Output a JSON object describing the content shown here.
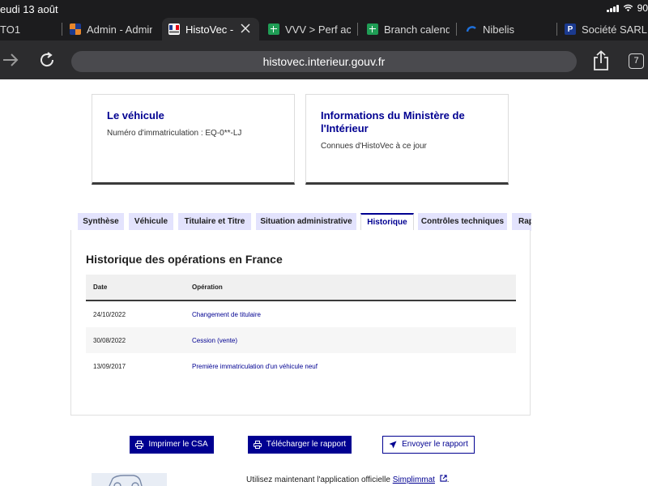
{
  "status_bar": {
    "time": "eudi 13 août",
    "battery": "90"
  },
  "browser_tabs": [
    {
      "label": "TO1",
      "icon": "none"
    },
    {
      "label": "Admin - Admin",
      "icon": "orange-blue-squares-icon",
      "icon_color": "#e8872b"
    },
    {
      "label": "HistoVec -",
      "icon": "histovec-logo-icon",
      "icon_color": "#ffffff",
      "active": true
    },
    {
      "label": "VVV > Perf ach",
      "icon": "green-grid-icon",
      "icon_color": "#1f9d55"
    },
    {
      "label": "Branch calenda",
      "icon": "green-grid-icon",
      "icon_color": "#1f9d55"
    },
    {
      "label": "Nibelis",
      "icon": "blue-arc-icon",
      "icon_color": "#1e6fd9"
    },
    {
      "label": "Société SARL",
      "icon": "letter-p-icon",
      "icon_color": "#1b3a8f",
      "icon_text": "P"
    }
  ],
  "toolbar": {
    "url": "histovec.interieur.gouv.fr",
    "tabs_count": "7"
  },
  "cards": {
    "vehicle": {
      "title": "Le véhicule",
      "plate": "Numéro d'immatriculation : EQ-0**-LJ"
    },
    "ministry": {
      "title": "Informations du Ministère de l'Intérieur",
      "subtitle": "Connues d'HistoVec à ce jour"
    }
  },
  "page_tabs": [
    {
      "label": "Synthèse"
    },
    {
      "label": "Véhicule"
    },
    {
      "label": "Titulaire et Titre"
    },
    {
      "label": "Situation administrative"
    },
    {
      "label": "Historique",
      "active": true
    },
    {
      "label": "Contrôles techniques"
    },
    {
      "label": "Rap"
    }
  ],
  "history": {
    "title": "Historique des opérations en France",
    "columns": {
      "date": "Date",
      "operation": "Opération"
    },
    "rows": [
      {
        "date": "24/10/2022",
        "operation": "Changement de titulaire"
      },
      {
        "date": "30/08/2022",
        "operation": "Cession (vente)"
      },
      {
        "date": "13/09/2017",
        "operation": "Première immatriculation d'un véhicule neuf"
      }
    ]
  },
  "actions": {
    "print": "Imprimer le CSA",
    "download": "Télécharger le rapport",
    "send": "Envoyer le rapport"
  },
  "promo": {
    "text": "Utilisez maintenant l'application officielle",
    "link": "Simplimmat",
    "suffix": "."
  },
  "colors": {
    "brand_blue": "#000091",
    "tab_inactive_bg": "#e3e3fd",
    "browser_chrome": "#1c1c1e"
  }
}
